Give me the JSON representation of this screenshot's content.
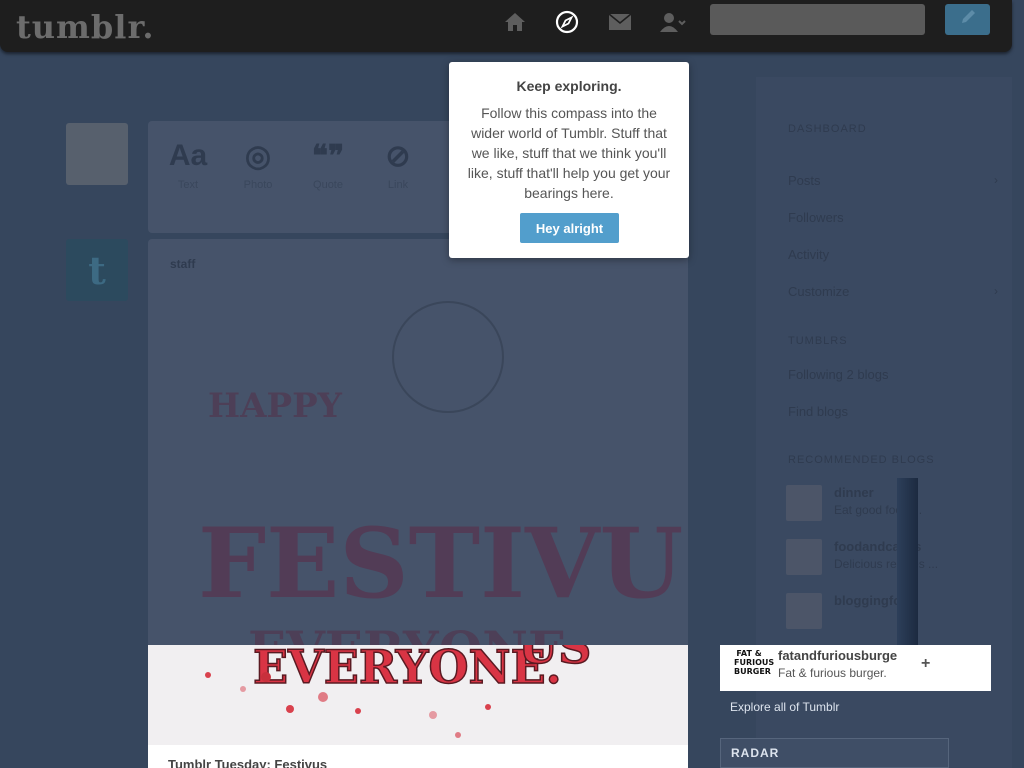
{
  "header": {
    "logo": "tumblr.",
    "icons": {
      "home": "home-icon",
      "explore": "compass-icon",
      "inbox": "mail-icon",
      "account": "account-icon",
      "post": "pencil-icon"
    },
    "search_value": ""
  },
  "post_types": [
    {
      "glyph": "Aa",
      "label": "Text"
    },
    {
      "glyph": "◎",
      "label": "Photo"
    },
    {
      "glyph": "❝❞",
      "label": "Quote"
    },
    {
      "glyph": "⊘",
      "label": "Link"
    }
  ],
  "post": {
    "author": "staff",
    "image_text_top": "HAPPY",
    "image_text_mid": "FESTIVUS",
    "image_text_bottom": "EVERYONE.",
    "title": "Tumblr Tuesday: Festivus"
  },
  "sidebar": {
    "dashboard_header": "DASHBOARD",
    "items": [
      {
        "label": "Posts"
      },
      {
        "label": "Followers"
      },
      {
        "label": "Activity"
      },
      {
        "label": "Customize"
      }
    ],
    "tumblrs_header": "TUMBLRS",
    "tumblr_items": [
      {
        "label": "Following 2 blogs"
      },
      {
        "label": "Find blogs"
      }
    ],
    "recommended_header": "RECOMMENDED BLOGS",
    "recommended": [
      {
        "name": "dinner",
        "desc": "Eat good food ..."
      },
      {
        "name": "foodandcakes",
        "desc": "Delicious recipes ..."
      },
      {
        "name": "bloggingfood",
        "desc": ""
      }
    ],
    "highlighted": {
      "name": "fatandfuriousburge",
      "desc": "Fat & furious burger.",
      "avatar_text": "FAT & FURIOUS BURGER"
    },
    "explore_all": "Explore all of Tumblr",
    "radar": "RADAR"
  },
  "popover": {
    "title": "Keep exploring.",
    "body": "Follow this compass into the wider world of Tumblr. Stuff that we like, stuff that we think you'll like, stuff that'll help you get your bearings here.",
    "button": "Hey alright"
  },
  "colors": {
    "overlay": "#36465d",
    "button": "#529ecc",
    "topbar": "#1e1e1e"
  }
}
